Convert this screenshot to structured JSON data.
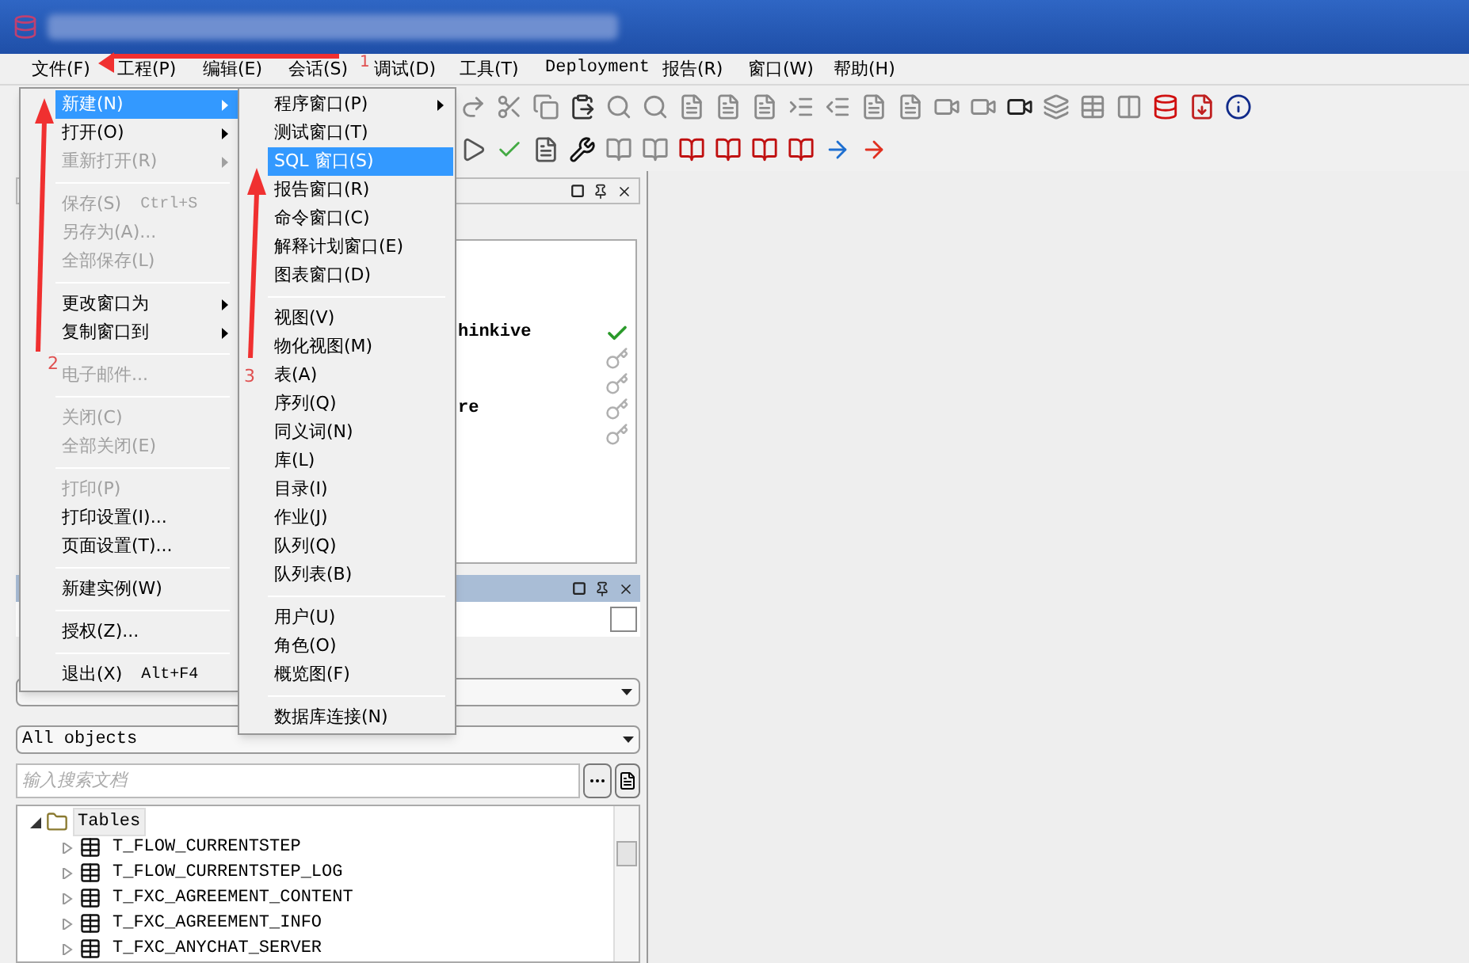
{
  "menu_bar": [
    "文件(F)",
    "工程(P)",
    "编辑(E)",
    "会话(S)",
    "调试(D)",
    "工具(T)",
    "Deployment",
    "报告(R)",
    "窗口(W)",
    "帮助(H)"
  ],
  "file_menu": [
    {
      "kind": "item",
      "label": "新建(N)",
      "selected": true,
      "disabled": false,
      "submenu": true
    },
    {
      "kind": "item",
      "label": "打开(O)",
      "selected": false,
      "disabled": false,
      "submenu": true
    },
    {
      "kind": "item",
      "label": "重新打开(R)",
      "selected": false,
      "disabled": true,
      "submenu": true
    },
    {
      "kind": "separator"
    },
    {
      "kind": "item",
      "label": "保存(S)",
      "shortcut": "Ctrl+S",
      "selected": false,
      "disabled": true,
      "submenu": false
    },
    {
      "kind": "item",
      "label": "另存为(A)...",
      "selected": false,
      "disabled": true,
      "submenu": false
    },
    {
      "kind": "item",
      "label": "全部保存(L)",
      "selected": false,
      "disabled": true,
      "submenu": false
    },
    {
      "kind": "separator"
    },
    {
      "kind": "item",
      "label": "更改窗口为",
      "selected": false,
      "disabled": false,
      "submenu": true
    },
    {
      "kind": "item",
      "label": "复制窗口到",
      "selected": false,
      "disabled": false,
      "submenu": true
    },
    {
      "kind": "separator"
    },
    {
      "kind": "item",
      "label": "电子邮件...",
      "selected": false,
      "disabled": true,
      "submenu": false
    },
    {
      "kind": "separator"
    },
    {
      "kind": "item",
      "label": "关闭(C)",
      "selected": false,
      "disabled": true,
      "submenu": false
    },
    {
      "kind": "item",
      "label": "全部关闭(E)",
      "selected": false,
      "disabled": true,
      "submenu": false
    },
    {
      "kind": "separator"
    },
    {
      "kind": "item",
      "label": "打印(P)",
      "selected": false,
      "disabled": true,
      "submenu": false
    },
    {
      "kind": "item",
      "label": "打印设置(I)...",
      "selected": false,
      "disabled": false,
      "submenu": false
    },
    {
      "kind": "item",
      "label": "页面设置(T)...",
      "selected": false,
      "disabled": false,
      "submenu": false
    },
    {
      "kind": "separator"
    },
    {
      "kind": "item",
      "label": "新建实例(W)",
      "selected": false,
      "disabled": false,
      "submenu": false
    },
    {
      "kind": "separator"
    },
    {
      "kind": "item",
      "label": "授权(Z)...",
      "selected": false,
      "disabled": false,
      "submenu": false
    },
    {
      "kind": "separator"
    },
    {
      "kind": "item",
      "label": "退出(X)",
      "shortcut": "Alt+F4",
      "selected": false,
      "disabled": false,
      "submenu": false
    }
  ],
  "new_submenu": [
    {
      "kind": "item",
      "label": "程序窗口(P)",
      "selected": false,
      "submenu": true
    },
    {
      "kind": "item",
      "label": "测试窗口(T)",
      "selected": false,
      "submenu": false
    },
    {
      "kind": "item",
      "label": "SQL 窗口(S)",
      "selected": true,
      "submenu": false
    },
    {
      "kind": "item",
      "label": "报告窗口(R)",
      "selected": false,
      "submenu": false
    },
    {
      "kind": "item",
      "label": "命令窗口(C)",
      "selected": false,
      "submenu": false
    },
    {
      "kind": "item",
      "label": "解释计划窗口(E)",
      "selected": false,
      "submenu": false
    },
    {
      "kind": "item",
      "label": "图表窗口(D)",
      "selected": false,
      "submenu": false
    },
    {
      "kind": "separator"
    },
    {
      "kind": "item",
      "label": "视图(V)",
      "selected": false,
      "submenu": false
    },
    {
      "kind": "item",
      "label": "物化视图(M)",
      "selected": false,
      "submenu": false
    },
    {
      "kind": "item",
      "label": "表(A)",
      "selected": false,
      "submenu": false
    },
    {
      "kind": "item",
      "label": "序列(Q)",
      "selected": false,
      "submenu": false
    },
    {
      "kind": "item",
      "label": "同义词(N)",
      "selected": false,
      "submenu": false
    },
    {
      "kind": "item",
      "label": "库(L)",
      "selected": false,
      "submenu": false
    },
    {
      "kind": "item",
      "label": "目录(I)",
      "selected": false,
      "submenu": false
    },
    {
      "kind": "item",
      "label": "作业(J)",
      "selected": false,
      "submenu": false
    },
    {
      "kind": "item",
      "label": "队列(Q)",
      "selected": false,
      "submenu": false
    },
    {
      "kind": "item",
      "label": "队列表(B)",
      "selected": false,
      "submenu": false
    },
    {
      "kind": "separator"
    },
    {
      "kind": "item",
      "label": "用户(U)",
      "selected": false,
      "submenu": false
    },
    {
      "kind": "item",
      "label": "角色(O)",
      "selected": false,
      "submenu": false
    },
    {
      "kind": "item",
      "label": "概览图(F)",
      "selected": false,
      "submenu": false
    },
    {
      "kind": "separator"
    },
    {
      "kind": "item",
      "label": "数据库连接(N)",
      "selected": false,
      "submenu": false
    }
  ],
  "windows_panel": {
    "rows": [
      {
        "text": "hinkive",
        "active": true
      },
      {
        "active": false
      },
      {
        "active": false
      },
      {
        "text": "re",
        "active": false
      },
      {
        "active": false
      }
    ]
  },
  "objects_panel": {
    "filter": "All objects",
    "search": {
      "placeholder": "输入搜索文档"
    },
    "tree": [
      {
        "label": "Tables",
        "expanded": true,
        "selected": true,
        "children": [
          {
            "label": "T_FLOW_CURRENTSTEP",
            "expanded": false,
            "selected": false
          },
          {
            "label": "T_FLOW_CURRENTSTEP_LOG",
            "expanded": false,
            "selected": false
          },
          {
            "label": "T_FXC_AGREEMENT_CONTENT",
            "expanded": false,
            "selected": false
          },
          {
            "label": "T_FXC_AGREEMENT_INFO",
            "expanded": false,
            "selected": false
          },
          {
            "label": "T_FXC_ANYCHAT_SERVER",
            "expanded": false,
            "selected": false
          }
        ]
      }
    ]
  },
  "annotations": [
    "1",
    "2",
    "3"
  ]
}
